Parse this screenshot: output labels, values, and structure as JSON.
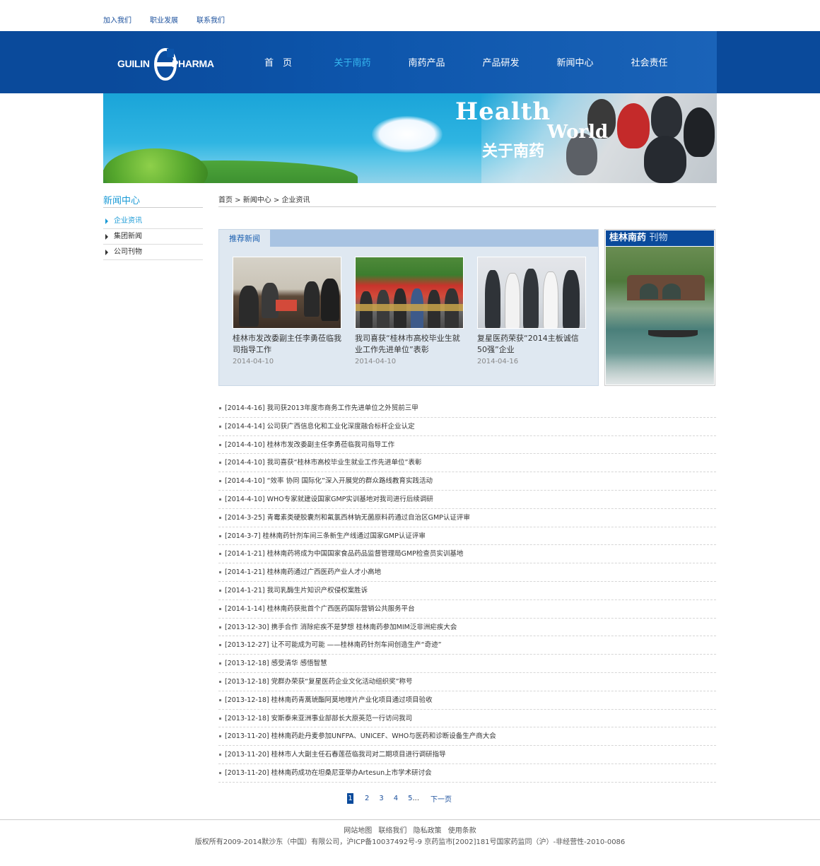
{
  "top_links": [
    "加入我们",
    "职业发展",
    "联系我们"
  ],
  "logo": {
    "left": "GUILIN",
    "right": "PHARMA"
  },
  "nav": [
    {
      "label": "首　页",
      "active": false
    },
    {
      "label": "关于南药",
      "active": true
    },
    {
      "label": "南药产品",
      "active": false
    },
    {
      "label": "产品研发",
      "active": false
    },
    {
      "label": "新闻中心",
      "active": false
    },
    {
      "label": "社会责任",
      "active": false
    }
  ],
  "banner": {
    "line1": "Health",
    "line2": "World",
    "line3": "关于南药"
  },
  "sidebar": {
    "title": "新闻中心",
    "items": [
      {
        "label": "企业资讯",
        "active": true
      },
      {
        "label": "集团新闻",
        "active": false
      },
      {
        "label": "公司刊物",
        "active": false
      }
    ]
  },
  "breadcrumb": "首页 > 新闻中心 > 企业资讯",
  "recommended": {
    "tab": "推荐新闻",
    "cards": [
      {
        "title": "桂林市发改委副主任李勇莅临我司指导工作",
        "date": "2014-04-10"
      },
      {
        "title": "我司喜获“桂林市高校毕业生就业工作先进单位”表彰",
        "date": "2014-04-10"
      },
      {
        "title": "复星医药荣获“2014主板诚信50强”企业",
        "date": "2014-04-16"
      }
    ]
  },
  "magazine": {
    "title": "桂林南药",
    "sub": "刊物"
  },
  "news": [
    "[2014-4-16] 我司获2013年度市商务工作先进单位之外贸前三甲",
    "[2014-4-14] 公司获广西信息化和工业化深度融合标杆企业认定",
    "[2014-4-10] 桂林市发改委副主任李勇莅临我司指导工作",
    "[2014-4-10] 我司喜获“桂林市高校毕业生就业工作先进单位”表彰",
    "[2014-4-10]  “效率 协同 国际化”深入开展党的群众路线教育实践活动",
    "[2014-4-10] WHO专家就建设国家GMP实训基地对我司进行后续调研",
    "[2014-3-25] 青霉素类硬胶囊剂和氟氯西林钠无菌原料药通过自治区GMP认证评审",
    "[2014-3-7] 桂林南药针剂车间三条新生产线通过国家GMP认证评审",
    "[2014-1-21] 桂林南药将成为中国国家食品药品监督管理局GMP检查员实训基地",
    "[2014-1-21] 桂林南药通过广西医药产业人才小高地",
    "[2014-1-21] 我司乳酶生片知识产权侵权案胜诉",
    "[2014-1-14] 桂林南药获批首个广西医药国际营销公共服务平台",
    "[2013-12-30] 携手合作 消除疟疾不是梦想 桂林南药参加MIM泛非洲疟疾大会",
    "[2013-12-27] 让不可能成为可能 ——桂林南药针剂车间创造生产“奇迹”",
    "[2013-12-18] 感受清华 感悟智慧",
    "[2013-12-18] 党群办荣获“复星医药企业文化活动组织奖”称号",
    "[2013-12-18] 桂林南药青蒿琥酯阿莫地喹片产业化项目通过项目验收",
    "[2013-12-18] 安斯泰来亚洲事业部部长大原英范一行访问我司",
    "[2013-11-20] 桂林南药赴丹麦参加UNFPA、UNICEF、WHO与医药和诊断设备生产商大会",
    "[2013-11-20] 桂林市人大副主任石春莲莅临我司对二期项目进行调研指导",
    "[2013-11-20] 桂林南药成功在坦桑尼亚举办Artesun上市学术研讨会"
  ],
  "pager": {
    "pages": [
      "1",
      "2",
      "3",
      "4",
      "5"
    ],
    "ellipsis": "...",
    "next": "下一页"
  },
  "footer": {
    "links": [
      "网站地图",
      "联络我们",
      "隐私政策",
      "使用条款"
    ],
    "copyright": "版权所有2009-2014默沙东（中国）有限公司，沪ICP备10037492号-9  京药监市[2002]181号国家药监同（沪）-非经营性-2010-0086"
  },
  "colors": {
    "brand_blue": "#0a4a9b",
    "accent_cyan": "#1a9ad6",
    "nav_active": "#36b8f0"
  }
}
